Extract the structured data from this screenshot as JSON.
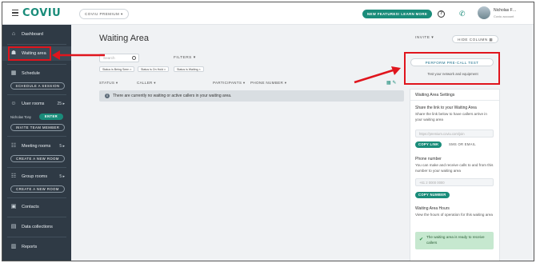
{
  "app": {
    "logo": "COVIU",
    "plan": "COVIU PREMIUM  ▾",
    "new_features": "NEW FEATURES! LEARN MORE",
    "user_name": "Nicholas F…",
    "user_sub": "Coviu account"
  },
  "sidebar": {
    "dashboard": "Dashboard",
    "waiting_area": "Waiting area",
    "schedule": "Schedule",
    "schedule_btn": "SCHEDULE A SESSION",
    "user_rooms": "User rooms",
    "user_rooms_count": "25 ▸",
    "user_room_name": "Nicholas Tony",
    "enter": "ENTER",
    "invite_team": "INVITE TEAM MEMBER",
    "meeting_rooms": "Meeting rooms",
    "meeting_rooms_count": "5 ▸",
    "create_room_1": "CREATE A NEW ROOM",
    "group_rooms": "Group rooms",
    "group_rooms_count": "5 ▸",
    "create_room_2": "CREATE A NEW ROOM",
    "contacts": "Contacts",
    "data_collections": "Data collections",
    "reports": "Reports"
  },
  "main": {
    "title": "Waiting Area",
    "invite": "INVITE  ▾",
    "hide_column": "HIDE COLUMN  ▦",
    "search_placeholder": "Search",
    "filters": "FILTERS  ▾",
    "chips": [
      "Status is Being Seen  ×",
      "Status is On Hold  ×",
      "Status is Waiting  ×"
    ],
    "columns": [
      "STATUS  ▾",
      "CALLER  ▾",
      "PARTICIPANTS  ▾",
      "PHONE NUMBER  ▾"
    ],
    "empty_msg": "There are currently no waiting or active callers in your waiting area.",
    "precall_btn": "PERFORM PRE-CALL TEST",
    "precall_sub": "Test your network and equipment"
  },
  "panel": {
    "header": "Waiting Area Settings",
    "share_title": "Share the link to your Waiting Area",
    "share_text": "Share the link below to have callers arrive in your waiting area",
    "link_value": "https://premium.coviu.com/join",
    "copy_link": "COPY LINK",
    "sms_email": "SMS OR EMAIL",
    "phone_title": "Phone number",
    "phone_text": "You can make and receive calls to and from this number to your waiting area",
    "phone_value": "+61 2 0000 0000",
    "copy_number": "COPY NUMBER",
    "hours_title": "Waiting Area Hours",
    "hours_text": "View the hours of operation for this waiting area",
    "ready_text": "The waiting area is ready to receive callers"
  },
  "colors": {
    "accent": "#1a8c7a",
    "sidebar": "#2f3a45",
    "annotation": "#e0151d"
  }
}
